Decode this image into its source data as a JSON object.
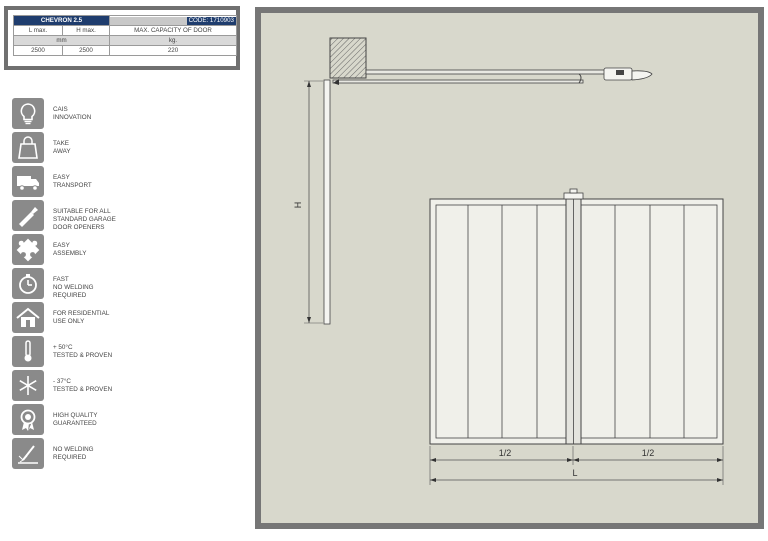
{
  "spec_table": {
    "model": "CHEVRON 2.5",
    "code": "CODE: 1710903",
    "headers": [
      "L max.",
      "H max.",
      "MAX. CAPACITY OF DOOR"
    ],
    "units": [
      "mm",
      "kg."
    ],
    "values": [
      "2500",
      "2500",
      "220"
    ]
  },
  "features": [
    {
      "icon": "lightbulb-icon",
      "label": "CAIS\nINNOVATION"
    },
    {
      "icon": "shopping-bag-icon",
      "label": "TAKE\nAWAY"
    },
    {
      "icon": "truck-icon",
      "label": "EASY\nTRANSPORT"
    },
    {
      "icon": "remote-control-icon",
      "label": "SUITABLE FOR ALL\nSTANDARD GARAGE\nDOOR OPENERS"
    },
    {
      "icon": "puzzle-icon",
      "label": "EASY\nASSEMBLY"
    },
    {
      "icon": "stopwatch-icon",
      "label": "FAST\nNO WELDING\nREQUIRED"
    },
    {
      "icon": "house-icon",
      "label": "FOR RESIDENTIAL\nUSE ONLY"
    },
    {
      "icon": "thermometer-icon",
      "label": "+ 50°C\nTESTED & PROVEN"
    },
    {
      "icon": "snowflake-icon",
      "label": "- 37°C\nTESTED & PROVEN"
    },
    {
      "icon": "quality-badge-icon",
      "label": "HIGH QUALITY\nGUARANTEED"
    },
    {
      "icon": "no-welding-icon",
      "label": "NO WELDING\nREQUIRED"
    }
  ],
  "drawing": {
    "height_label": "H",
    "half_label_left": "1/2",
    "half_label_right": "1/2",
    "width_label": "L"
  },
  "colors": {
    "header_blue": "#1f3d6e",
    "icon_grey": "#8a8a8a",
    "drawing_bg": "#d8d8cc",
    "frame_grey": "#767676"
  }
}
